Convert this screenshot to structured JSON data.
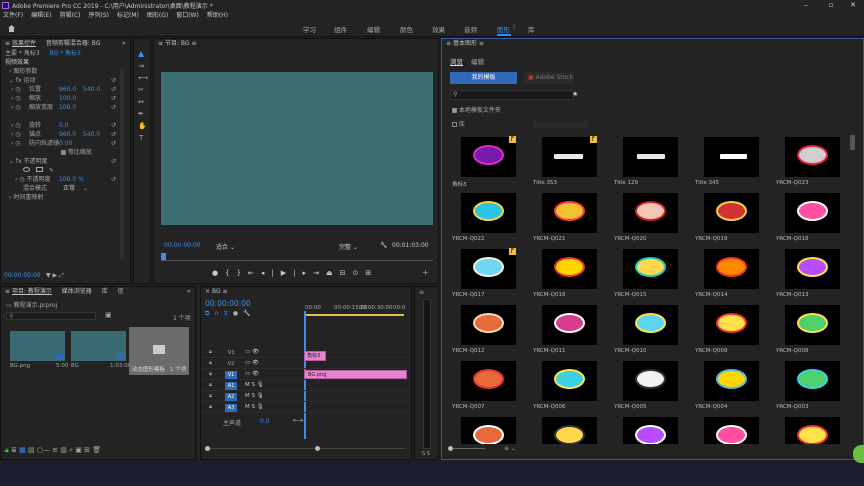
{
  "titlebar": {
    "title": "Adobe Premiere Pro CC 2019 - C:\\用户\\Administrator\\桌面\\教程演示 *"
  },
  "menu": [
    "文件(F)",
    "编辑(E)",
    "剪辑(C)",
    "序列(S)",
    "标记(M)",
    "图形(G)",
    "窗口(W)",
    "帮助(H)"
  ],
  "workspaces": [
    "学习",
    "组件",
    "编辑",
    "颜色",
    "效果",
    "音频",
    "图形",
    "库"
  ],
  "effect_controls": {
    "tabs": [
      "效果控件",
      "音频剪辑混合器: BG"
    ],
    "clip_label": "主要 * 角标3",
    "seq_label": "BG * 角标3",
    "video_effects": "视频效果",
    "graphic": "图形参数",
    "motion": "运动",
    "rows": [
      {
        "label": "位置",
        "v1": "960.0",
        "v2": "540.0"
      },
      {
        "label": "缩放",
        "v1": "100.0",
        "v2": ""
      },
      {
        "label": "缩放宽度",
        "v1": "100.0",
        "v2": ""
      },
      {
        "label": "",
        "v1": "",
        "v2": ""
      },
      {
        "label": "旋转",
        "v1": "0.0",
        "v2": ""
      },
      {
        "label": "锚点",
        "v1": "960.0",
        "v2": "540.0"
      },
      {
        "label": "防闪烁滤镜",
        "v1": "0.00",
        "v2": ""
      }
    ],
    "uniform": "等比缩放",
    "opacity": "不透明度",
    "opacity_label": "不透明度",
    "opacity_value": "100.0 %",
    "blend": "混合模式",
    "blend_value": "正常",
    "time_remap": "时间重映射",
    "timecode": "00:00:00:00"
  },
  "program": {
    "title": "节目: BG",
    "timecode": "00:00:00:00",
    "fit": "适合",
    "quality": "完整",
    "duration": "00:01:03:00",
    "screen_color": "#3b6e73"
  },
  "project": {
    "tabs": [
      "项目: 教程演示",
      "媒体浏览器",
      "库",
      "信"
    ],
    "file": "教程演示.prproj",
    "count": "1 个项",
    "items": [
      {
        "name": "BG.png",
        "dur": "5:00"
      },
      {
        "name": "BG",
        "dur": "1:03:00"
      },
      {
        "name": "动态图形模板",
        "dur": "1 个项"
      }
    ]
  },
  "timeline": {
    "timecode": "00:00:00:00",
    "ruler": [
      "00:00",
      "00:00:15:00",
      "00:00:30:00",
      "00:0"
    ],
    "tracks": [
      {
        "id": "V3",
        "type": "video"
      },
      {
        "id": "V2",
        "type": "video"
      },
      {
        "id": "V1",
        "type": "video"
      },
      {
        "id": "A1",
        "type": "audio"
      },
      {
        "id": "A2",
        "type": "audio"
      },
      {
        "id": "A3",
        "type": "audio"
      }
    ],
    "master": "主声道",
    "master_val": "0.0",
    "clips": [
      {
        "track": "V2",
        "label": "角标3"
      },
      {
        "track": "V1",
        "label": "BG.png"
      }
    ]
  },
  "essential_graphics": {
    "title": "基本图形",
    "tabs": [
      "浏览",
      "编辑"
    ],
    "my_templates": "我的模板",
    "adobe_stock": "Adobe Stock",
    "local_folder": "本地模板文件夹",
    "library": "库",
    "grid": [
      [
        "角标3",
        "Title 353",
        "Title 129",
        "Title 345",
        "YRCM-Q023"
      ],
      [
        "YRCM-Q022",
        "YRCM-Q021",
        "YRCM-Q020",
        "YRCM-Q019",
        "YRCM-Q018"
      ],
      [
        "YRCM-Q017",
        "YRCM-Q016",
        "YRCM-Q015",
        "YRCM-Q014",
        "YRCM-Q013"
      ],
      [
        "YRCM-Q012",
        "YRCM-Q011",
        "YRCM-Q010",
        "YRCM-Q009",
        "YRCM-Q008"
      ],
      [
        "YRCM-Q007",
        "YRCM-Q006",
        "YRCM-Q005",
        "YRCM-Q004",
        "YRCM-Q003"
      ],
      [
        "",
        "",
        "",
        "",
        ""
      ]
    ]
  },
  "colors": {
    "accent": "#3b8fea",
    "pink": "#e584cf",
    "panel": "#232323",
    "bg": "#1e1e1e"
  }
}
